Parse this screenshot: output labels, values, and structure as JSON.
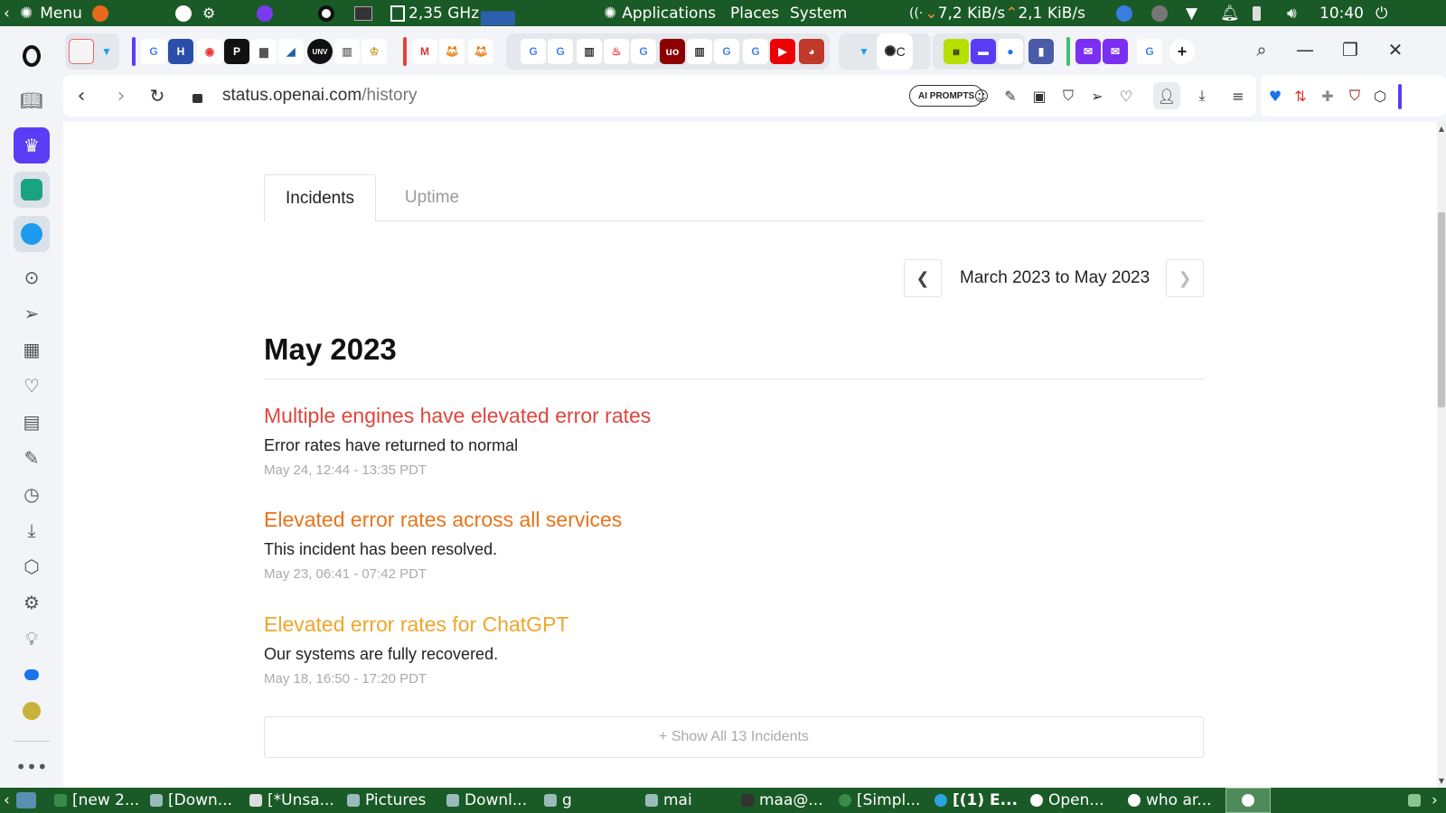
{
  "top_panel": {
    "menu_label": "Menu",
    "cpu": "2,35 GHz",
    "applications": "Applications",
    "places": "Places",
    "system": "System",
    "net_down": "7,2 KiB/s",
    "net_up": "2,1 KiB/s",
    "clock": "10:40"
  },
  "browser": {
    "url_host": "status.openai.com",
    "url_path": "/history",
    "ai_prompts": "AI PROMPTS",
    "active_tab_fragment": "C"
  },
  "page": {
    "tabs": [
      {
        "label": "Incidents",
        "active": true
      },
      {
        "label": "Uptime",
        "active": false
      }
    ],
    "pager_label": "March 2023 to May 2023",
    "month_title": "May 2023",
    "incidents": [
      {
        "title": "Multiple engines have elevated error rates",
        "message": "Error rates have returned to normal",
        "time": "May 24, 12:44 - 13:35 PDT",
        "color": "#e0453e"
      },
      {
        "title": "Elevated error rates across all services",
        "message": "This incident has been resolved.",
        "time": "May 23, 06:41 - 07:42 PDT",
        "color": "#e8741c"
      },
      {
        "title": "Elevated error rates for ChatGPT",
        "message": "Our systems are fully recovered.",
        "time": "May 18, 16:50 - 17:20 PDT",
        "color": "#f1a52b"
      }
    ],
    "show_all": "+ Show All 13 Incidents"
  },
  "taskbar": {
    "items": [
      "[new 2...",
      "[Down...",
      "[*Unsa...",
      "Pictures",
      "Downl...",
      "g",
      "mai",
      "maa@...",
      "[Simpl...",
      "[(1) E...",
      "Open...",
      "who ar..."
    ]
  },
  "colors": {
    "panel_green": "#1a5a26",
    "opera_purple": "#5b3cf5"
  }
}
